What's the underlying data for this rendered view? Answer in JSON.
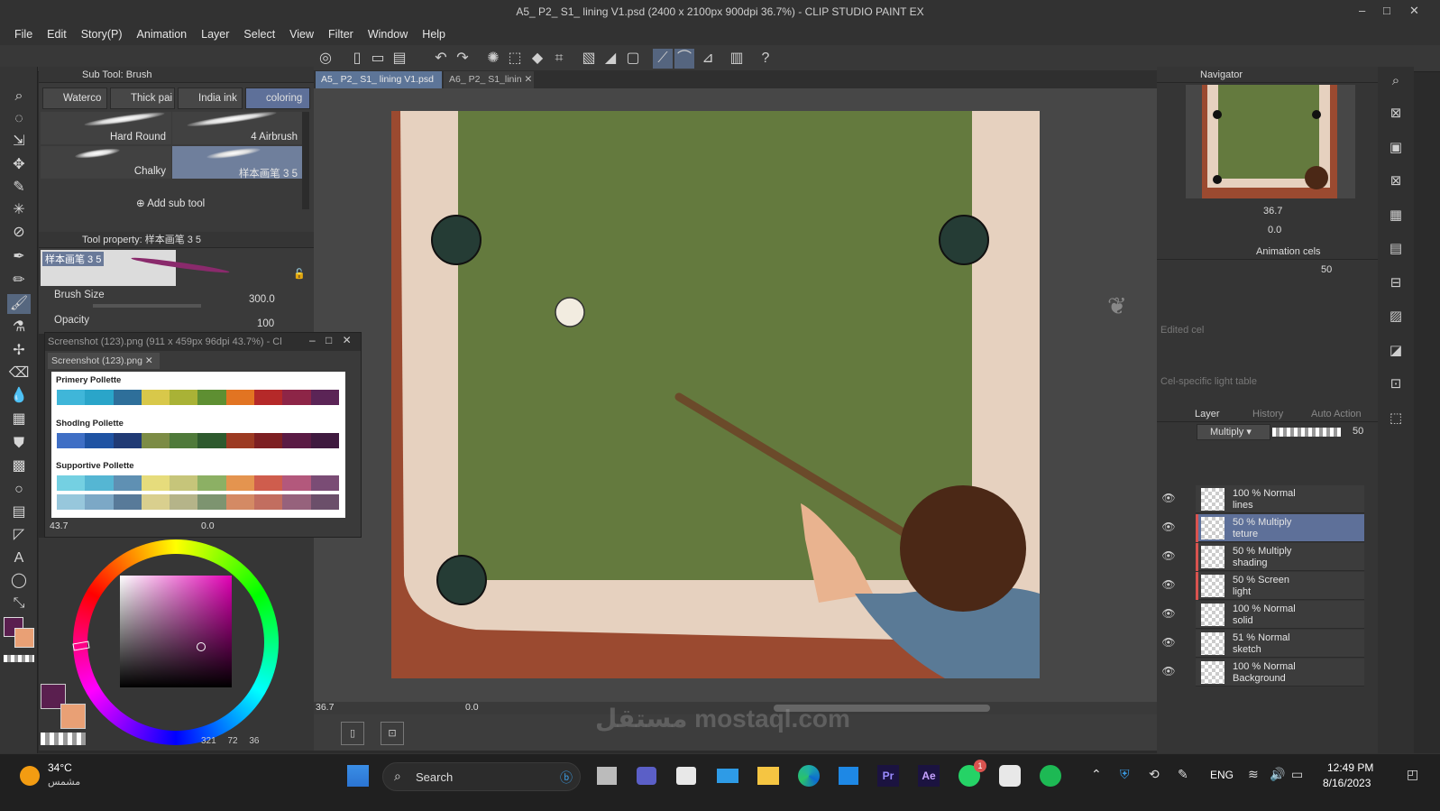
{
  "window": {
    "title": "A5_ P2_ S1_ lining V1.psd (2400 x 2100px 900dpi 36.7%) - CLIP STUDIO PAINT EX",
    "controls": [
      "–",
      "□",
      "✕"
    ]
  },
  "menu": [
    "File",
    "Edit",
    "Story(P)",
    "Animation",
    "Layer",
    "Select",
    "View",
    "Filter",
    "Window",
    "Help"
  ],
  "subtool": {
    "header": "Sub Tool: Brush",
    "tabs": [
      "Waterco",
      "Thick pai",
      "India ink",
      "coloring"
    ],
    "brushes": [
      "Hard Round",
      "4 Airbrush",
      "Chalky",
      "样本画笔 3 5"
    ],
    "add_label": "Add sub tool"
  },
  "toolprop": {
    "header": "Tool property: 样本画笔 3 5",
    "preview_label": "样本画笔 3 5",
    "brush_size_label": "Brush Size",
    "brush_size_value": "300.0",
    "opacity_label": "Opacity",
    "opacity_value": "100"
  },
  "doc_tabs": [
    "A5_ P2_ S1_ lining V1.psd",
    "A6_ P2_ S1_linin"
  ],
  "subview": {
    "title": "Screenshot (123).png (911 x 459px 96dpi 43.7%) - Cl",
    "tab": "Screenshot (123).png",
    "zoom": "43.7",
    "angle": "0.0",
    "palettes": [
      {
        "label": "Primery Pollette",
        "colors": [
          "#3fb6d9",
          "#2aa5c9",
          "#2e6f9a",
          "#d8c84a",
          "#a9b236",
          "#5e8f32",
          "#e27422",
          "#b52929",
          "#8d2547",
          "#5b2456"
        ]
      },
      {
        "label": "Shodlng Pollette",
        "colors": [
          "#3f6fc5",
          "#1f53a3",
          "#203a75",
          "#7c8c45",
          "#4f7a3a",
          "#2e5a2e",
          "#9c3a22",
          "#7d1f22",
          "#5a1b44",
          "#3f1a3f"
        ]
      },
      {
        "label": "Supportive Pollette",
        "colors": [
          "#74d0e2",
          "#55b6d3",
          "#5f90b3",
          "#e6dc7c",
          "#c6c57a",
          "#8cb064",
          "#e4944f",
          "#cf5d4d",
          "#b3587c",
          "#7a4c75"
        ]
      },
      {
        "label": "",
        "colors": [
          "#97c7dc",
          "#7ca8c6",
          "#587a99",
          "#d9cf8e",
          "#b5b489",
          "#7d9470",
          "#d48a64",
          "#c26e60",
          "#96627c",
          "#6b4f6a"
        ]
      }
    ]
  },
  "color": {
    "main": "#5a1f4f",
    "sub": "#e9a075",
    "info_a": "321",
    "info_b": "72",
    "info_c": "36"
  },
  "canvas_footer": {
    "zoom": "36.7",
    "angle": "0.0"
  },
  "navigator": {
    "label": "Navigator",
    "zoom": "36.7",
    "angle": "0.0"
  },
  "animation": {
    "label": "Animation cels",
    "value": "50",
    "edited_cel": "Edited cel",
    "light_table": "Cel-specific light table"
  },
  "layer_panel": {
    "tabs": [
      "Layer",
      "History",
      "Auto Action"
    ],
    "blend_mode": "Multiply",
    "opacity": "50",
    "layers": [
      {
        "line1": "100 % Normal",
        "line2": "lines",
        "color": "",
        "selected": false
      },
      {
        "line1": "50 % Multiply",
        "line2": "teture",
        "color": "#d9534f",
        "selected": true
      },
      {
        "line1": "50 % Multiply",
        "line2": "shading",
        "color": "#d9534f",
        "selected": false
      },
      {
        "line1": "50 % Screen",
        "line2": "light",
        "color": "#d9534f",
        "selected": false
      },
      {
        "line1": "100 % Normal",
        "line2": "solid",
        "color": "",
        "selected": false
      },
      {
        "line1": "51 % Normal",
        "line2": "sketch",
        "color": "",
        "selected": false
      },
      {
        "line1": "100 % Normal",
        "line2": "Background",
        "color": "",
        "selected": false
      }
    ]
  },
  "taskbar": {
    "weather_temp": "34°C",
    "weather_desc": "مشمس",
    "search": "Search",
    "lang": "ENG",
    "time": "12:49 PM",
    "date": "8/16/2023",
    "whatsapp_badge": "1",
    "apps": [
      "Pr",
      "Ae"
    ]
  },
  "watermark": "مستقل mostaql.com"
}
